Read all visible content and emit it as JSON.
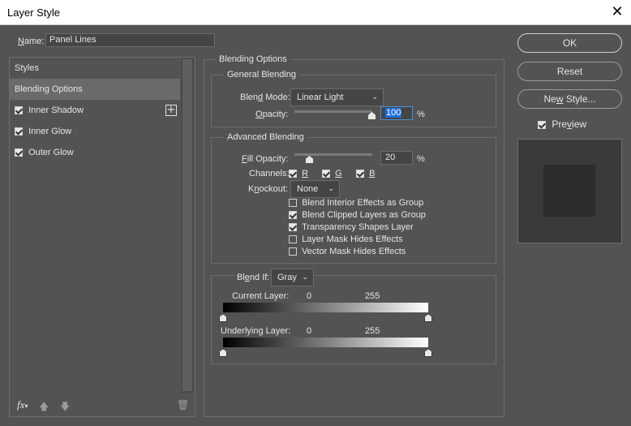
{
  "window": {
    "title": "Layer Style",
    "close_label": "✕"
  },
  "name": {
    "label": "Name:",
    "value": "Panel Lines"
  },
  "styles_list": {
    "header": "Styles",
    "items": [
      {
        "label": "Blending Options",
        "selected": true
      },
      {
        "label": "Inner Shadow",
        "checked": true
      },
      {
        "label": "Inner Glow",
        "checked": true
      },
      {
        "label": "Outer Glow",
        "checked": true
      }
    ],
    "add_label": "+",
    "bottom_icons": [
      "fx-icon",
      "arrow-up-icon",
      "arrow-down-icon",
      "trash-icon"
    ]
  },
  "blending_options": {
    "section_title": "Blending Options",
    "general": {
      "title": "General Blending",
      "blend_mode_label": "Blend Mode:",
      "blend_mode_value": "Linear Light",
      "opacity_label": "Opacity:",
      "opacity_value": "100",
      "opacity_unit": "%",
      "opacity_level": 1.0
    },
    "advanced": {
      "title": "Advanced Blending",
      "fill_opacity_label": "Fill Opacity:",
      "fill_opacity_value": "20",
      "fill_opacity_unit": "%",
      "fill_opacity_level": 0.2,
      "channels_label": "Channels:",
      "channels": [
        {
          "label": "R",
          "checked": true
        },
        {
          "label": "G",
          "checked": true
        },
        {
          "label": "B",
          "checked": true
        }
      ],
      "knockout_label": "Knockout:",
      "knockout_value": "None",
      "options": [
        {
          "label": "Blend Interior Effects as Group",
          "checked": false
        },
        {
          "label": "Blend Clipped Layers as Group",
          "checked": true
        },
        {
          "label": "Transparency Shapes Layer",
          "checked": true
        },
        {
          "label": "Layer Mask Hides Effects",
          "checked": false
        },
        {
          "label": "Vector Mask Hides Effects",
          "checked": false
        }
      ]
    },
    "blend_if": {
      "label": "Blend If:",
      "value": "Gray",
      "current_layer_label": "Current Layer:",
      "current_low": "0",
      "current_high": "255",
      "underlying_layer_label": "Underlying Layer:",
      "underlying_low": "0",
      "underlying_high": "255"
    }
  },
  "buttons": {
    "ok": "OK",
    "reset": "Reset",
    "new_style": "New Style...",
    "preview_label": "Preview",
    "preview_checked": true
  }
}
